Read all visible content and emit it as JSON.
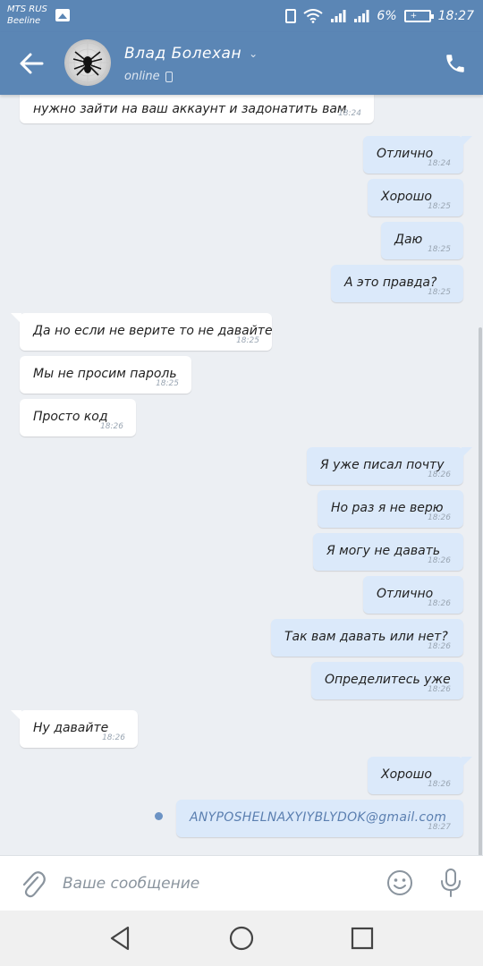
{
  "status_bar": {
    "carrier_1": "MTS RUS",
    "carrier_2": "Beeline",
    "battery": "6%",
    "time": "18:27"
  },
  "header": {
    "contact_name": "Влад Болехан",
    "presence": "online",
    "color": "#5b86b5"
  },
  "messages": [
    {
      "dir": "in",
      "text": "нужно зайти на ваш аккаунт и задонатить вам",
      "time": "18:24"
    },
    {
      "dir": "out",
      "text": "Отлично",
      "time": "18:24"
    },
    {
      "dir": "out",
      "text": "Хорошо",
      "time": "18:25"
    },
    {
      "dir": "out",
      "text": "Даю",
      "time": "18:25"
    },
    {
      "dir": "out",
      "text": "А это правда?",
      "time": "18:25"
    },
    {
      "dir": "in",
      "text": "Да но если не верите то не давайте",
      "time": "18:25"
    },
    {
      "dir": "in",
      "text": "Мы не просим пароль",
      "time": "18:25"
    },
    {
      "dir": "in",
      "text": "Просто код",
      "time": "18:26"
    },
    {
      "dir": "out",
      "text": "Я уже писал почту",
      "time": "18:26"
    },
    {
      "dir": "out",
      "text": "Но раз я не верю",
      "time": "18:26"
    },
    {
      "dir": "out",
      "text": "Я могу не давать",
      "time": "18:26"
    },
    {
      "dir": "out",
      "text": "Отлично",
      "time": "18:26"
    },
    {
      "dir": "out",
      "text": "Так вам давать или нет?",
      "time": "18:26"
    },
    {
      "dir": "out",
      "text": "Определитесь уже",
      "time": "18:26"
    },
    {
      "dir": "in",
      "text": "Ну давайте",
      "time": "18:26"
    },
    {
      "dir": "out",
      "text": "Хорошо",
      "time": "18:26"
    },
    {
      "dir": "out",
      "text": "ANYPOSHELNAXYIYBLYDOK@gmail.com",
      "time": "18:27"
    }
  ],
  "composer": {
    "placeholder": "Ваше сообщение"
  },
  "icons": {
    "back": "arrow-left-icon",
    "call": "phone-icon",
    "attach": "paperclip-icon",
    "emoji": "smiley-icon",
    "mic": "microphone-icon"
  }
}
